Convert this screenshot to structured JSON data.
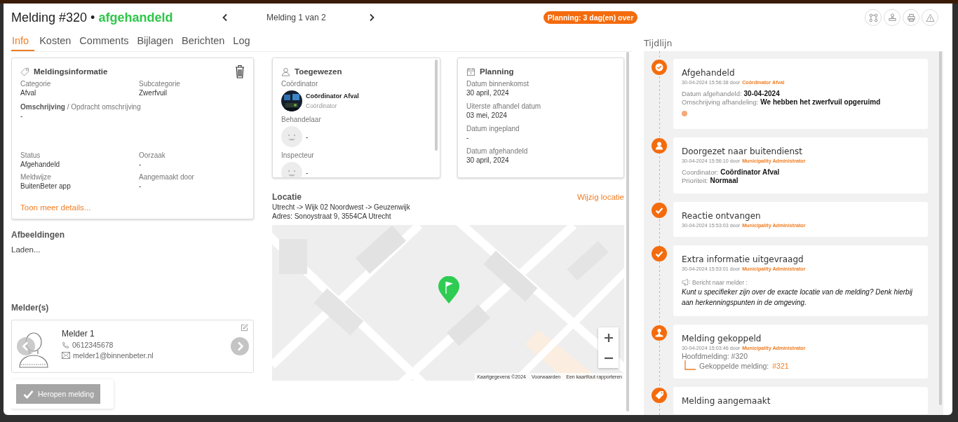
{
  "header": {
    "title": "Melding #320 •",
    "status": {
      "label": "afgehandeld",
      "kind": "closed"
    },
    "pager": "Melding 1 van 2",
    "planning_badge": "Planning: 3 dag(en) over"
  },
  "tabs": [
    {
      "label": "Info",
      "selected": true
    },
    {
      "label": "Kosten",
      "selected": false
    },
    {
      "label": "Comments",
      "selected": false
    },
    {
      "label": "Bijlagen",
      "selected": false
    },
    {
      "label": "Berichten",
      "selected": false
    },
    {
      "label": "Log",
      "selected": false
    }
  ],
  "melding_info": {
    "title": "Meldingsinformatie",
    "fields_top": [
      {
        "label": "Categorie",
        "value": "Afval"
      },
      {
        "label": "Subcategorie",
        "value": "Zwerfvuil"
      }
    ],
    "description": {
      "label": "**Omschrijving** / Opdracht omschrijving",
      "value": "-"
    },
    "fields_bottom": [
      {
        "label": "Status",
        "value": "Afgehandeld"
      },
      {
        "label": "Oorzaak",
        "value": "-"
      },
      {
        "label": "Meldwijze",
        "value": "BuitenBeter app"
      },
      {
        "label": "Aangemaakt door",
        "value": "-"
      }
    ],
    "details_link": "Toon meer details..."
  },
  "afbeeldingen": {
    "title": "Afbeeldingen",
    "status": "Laden..."
  },
  "melders": {
    "title": "Melder(s)",
    "items": [
      {
        "name": "Melder 1",
        "phone": "0612345678",
        "email": "melder1@binnenbeter.nl"
      }
    ]
  },
  "reopen_button": "Heropen melding",
  "toegewezen": {
    "title": "Toegewezen",
    "roles": [
      {
        "label": "Coördinator",
        "name": "Coördinator Afval",
        "subtitle": "Coördinator"
      },
      {
        "label": "Behandelaar",
        "kind": "placeholder",
        "name": "-"
      },
      {
        "label": "Inspecteur",
        "kind": "placeholder",
        "name": "-"
      }
    ]
  },
  "planning": {
    "title": "Planning",
    "fields": [
      {
        "label": "Datum binnenkomst",
        "value": "30 april, 2024"
      },
      {
        "label": "Uiterste afhandel datum",
        "value": "03 mei, 2024"
      },
      {
        "label": "Datum ingepland",
        "value": "-"
      },
      {
        "label": "Datum afgehandeld",
        "value": "30 april, 2024"
      }
    ]
  },
  "locatie": {
    "title": "Locatie",
    "path": "Utrecht -> Wijk 02 Noordwest -> Geuzenwijk",
    "address": "Adres: Sonoystraat 9, 3554CA Utrecht",
    "change_link": "Wijzig locatie",
    "map": {
      "kind": "picture",
      "attribution": [
        "Kaartgegevens ©2024",
        "Voorwaarden",
        "Een kaartfout rapporteren"
      ]
    }
  },
  "timeline": {
    "title": "Tijdlijn",
    "events": [
      {
        "kind": "check-ring",
        "title": "Afgehandeld",
        "meta": "30-04-2024 15:56:38 door",
        "author": "Coördinator Afval",
        "details": [
          {
            "label": "Datum afgehandeld:",
            "value": "30-04-2024"
          },
          {
            "label": "Omschrijving afhandeling:",
            "value": "We hebben het zwerfvuil opgeruimd"
          }
        ],
        "has_dot": true
      },
      {
        "kind": "person",
        "title": "Doorgezet naar buitendienst",
        "meta": "30-04-2024 15:56:10 door",
        "author": "Municipality Administrator",
        "details": [
          {
            "label": "Coordinator:",
            "value": "Coördinator Afval"
          },
          {
            "label": "Prioriteit:",
            "value": "Normaal"
          }
        ]
      },
      {
        "kind": "check",
        "title": "Reactie ontvangen",
        "meta": "30-04-2024 15:53:03 door",
        "author": "Municipality Administrator"
      },
      {
        "kind": "check",
        "title": "Extra informatie uitgevraagd",
        "meta": "30-04-2024 15:53:01 door",
        "author": "Municipality Administrator",
        "message": {
          "label": "Bericht naar melder :",
          "text": "Kunt u specifieker zijn over de exacte locatie van de melding? Denk hierbij aan herkenningspunten in de omgeving."
        }
      },
      {
        "kind": "stamp",
        "title": "Melding gekoppeld",
        "meta": "30-04-2024 15:03:46 door",
        "author": "Municipality Administrator",
        "link": {
          "main": "Hoofdmelding: #320",
          "label": "Gekoppelde melding:",
          "value": "#321"
        }
      },
      {
        "kind": "tag",
        "title": "Melding aangemaakt"
      }
    ]
  }
}
